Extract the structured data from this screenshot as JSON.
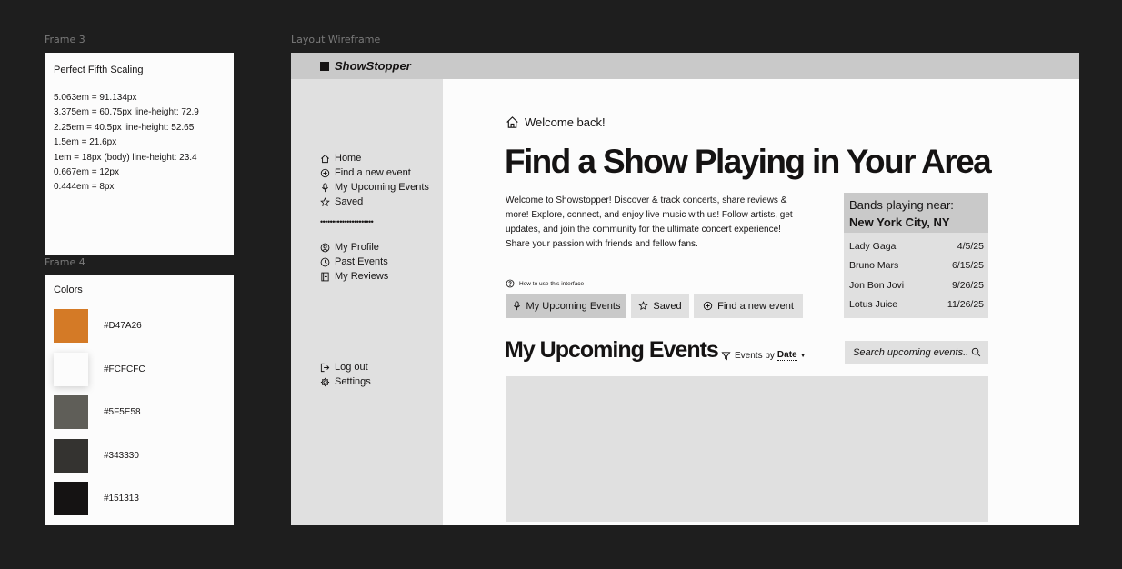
{
  "frames": {
    "frame3_label": "Frame 3",
    "frame4_label": "Frame 4",
    "wireframe_label": "Layout Wireframe"
  },
  "typography": {
    "title": "Perfect Fifth Scaling",
    "lines": [
      "5.063em = 91.134px",
      "3.375em = 60.75px line-height: 72.9",
      "2.25em = 40.5px line-height: 52.65",
      "1.5em = 21.6px",
      "1em = 18px (body) line-height: 23.4",
      "0.667em = 12px",
      "0.444em = 8px"
    ]
  },
  "palette": {
    "title": "Colors",
    "colors": [
      "#D47A26",
      "#FCFCFC",
      "#5F5E58",
      "#343330",
      "#151313"
    ]
  },
  "app": {
    "brand": "ShowStopper",
    "nav": {
      "home": "Home",
      "find": "Find a new event",
      "upcoming": "My Upcoming Events",
      "saved": "Saved",
      "divider": "••••••••••••••••••••••",
      "profile": "My Profile",
      "past": "Past Events",
      "reviews": "My Reviews",
      "logout": "Log out",
      "settings": "Settings"
    },
    "welcome": "Welcome back!",
    "heading": "Find a Show Playing in Your Area",
    "intro": "Welcome to Showstopper! Discover & track concerts, share reviews & more! Explore, connect, and enjoy live music with us! Follow artists, get updates, and join the community for the ultimate concert experience! Share your passion with friends and fellow fans.",
    "bands": {
      "title": "Bands playing near:",
      "city": "New York City, NY",
      "rows": [
        {
          "name": "Lady Gaga",
          "date": "4/5/25"
        },
        {
          "name": "Bruno Mars",
          "date": "6/15/25"
        },
        {
          "name": "Jon Bon Jovi",
          "date": "9/26/25"
        },
        {
          "name": "Lotus Juice",
          "date": "11/26/25"
        }
      ]
    },
    "help": "How to use this interface",
    "buttons": {
      "upcoming": "My Upcoming Events",
      "saved": "Saved",
      "find": "Find a new event"
    },
    "section_title": "My Upcoming Events",
    "sort": {
      "label": "Events by",
      "value": "Date"
    },
    "search_placeholder": "Search upcoming events..."
  }
}
